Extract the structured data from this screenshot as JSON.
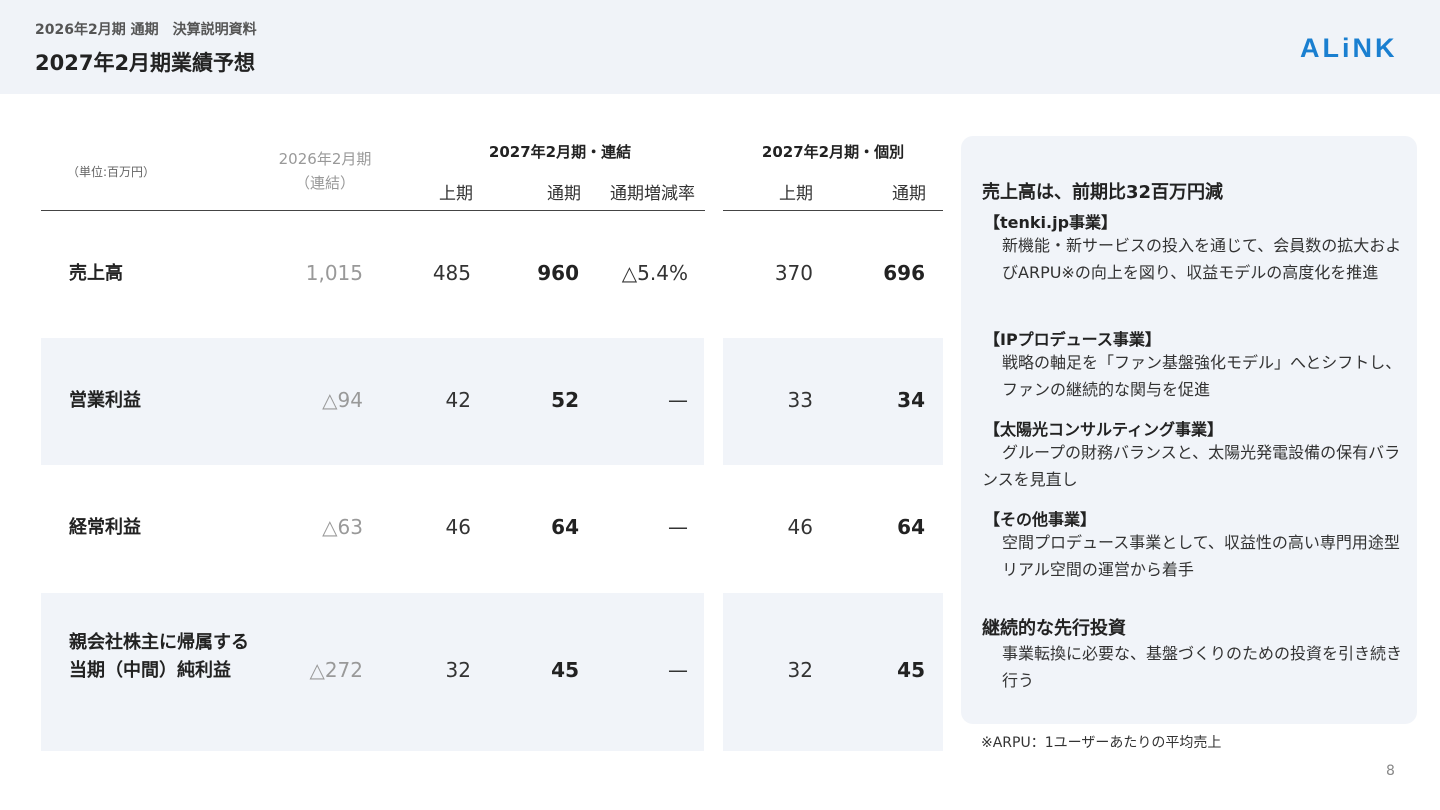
{
  "header": {
    "subtitle": "2026年2月期 通期　決算説明資料",
    "title": "2027年2月期業績予想",
    "logo_text": "ALiNK"
  },
  "colors": {
    "brand": "#1a7fd0",
    "band": "#f1f4f9",
    "header_bg": "#f0f3f8"
  },
  "table": {
    "unit": "（単位:百万円）",
    "prev_header": {
      "line1": "2026年2月期",
      "line2": "（連結）"
    },
    "group_consolidated": "2027年2月期・連結",
    "group_individual": "2027年2月期・個別",
    "columns": {
      "c_first_half": "上期",
      "c_full_year": "通期",
      "c_change_rate": "通期増減率",
      "i_first_half": "上期",
      "i_full_year": "通期"
    },
    "rows": [
      {
        "label1": "売上高",
        "label2": "",
        "prev": "1,015",
        "c_h1": "485",
        "c_fy": "960",
        "c_rate": "△5.4%",
        "i_h1": "370",
        "i_fy": "696"
      },
      {
        "label1": "営業利益",
        "label2": "",
        "prev": "△94",
        "c_h1": "42",
        "c_fy": "52",
        "c_rate": "—",
        "i_h1": "33",
        "i_fy": "34"
      },
      {
        "label1": "経常利益",
        "label2": "",
        "prev": "△63",
        "c_h1": "46",
        "c_fy": "64",
        "c_rate": "—",
        "i_h1": "46",
        "i_fy": "64"
      },
      {
        "label1": "親会社株主に帰属する",
        "label2": "当期（中間）純利益",
        "prev": "△272",
        "c_h1": "32",
        "c_fy": "45",
        "c_rate": "—",
        "i_h1": "32",
        "i_fy": "45"
      }
    ]
  },
  "side": {
    "heading1": "売上高は、前期比32百万円減",
    "tenki_title": "【tenki.jp事業】",
    "tenki_body": "新機能・新サービスの投入を通じて、会員数の拡大およびARPU※の向上を図り、収益モデルの高度化を推進",
    "ip_title": "【IPプロデュース事業】",
    "ip_body": "戦略の軸足を「ファン基盤強化モデル」へとシフトし、ファンの継続的な関与を促進",
    "solar_title": "【太陽光コンサルティング事業】",
    "solar_body": "グループの財務バランスと、太陽光発電設備の保有バランスを見直し",
    "other_title": "【その他事業】",
    "other_body": "空間プロデュース事業として、収益性の高い専門用途型リアル空間の運営から着手",
    "heading2": "継続的な先行投資",
    "invest_body": "事業転換に必要な、基盤づくりのための投資を引き続き行う"
  },
  "footnote": "※ARPU：1ユーザーあたりの平均売上",
  "page_number": "8"
}
